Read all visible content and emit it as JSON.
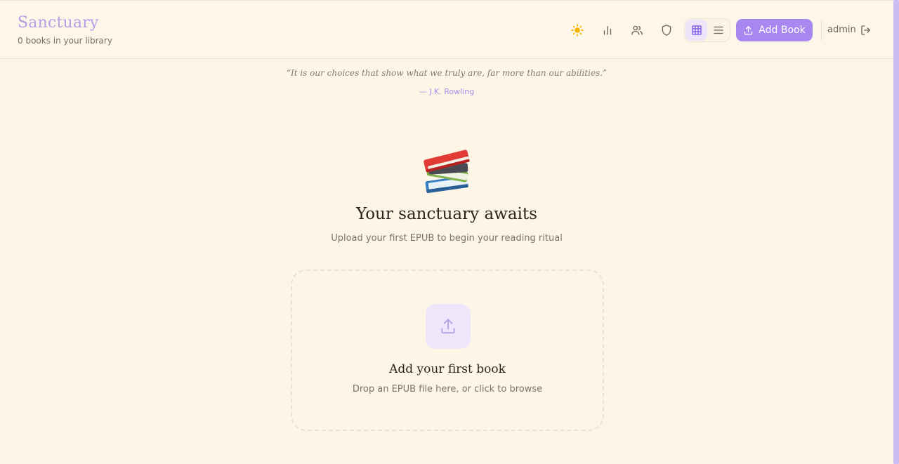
{
  "header": {
    "title": "Sanctuary",
    "subtitle": "0 books in your library",
    "icons": [
      "sun-icon",
      "stats-icon",
      "users-icon",
      "shield-icon",
      "grid-view-icon",
      "list-view-icon"
    ],
    "add_book_label": "Add Book",
    "username": "admin"
  },
  "quote": {
    "text": "“It is our choices that show what we truly are, far more than our abilities.”",
    "author": "— J.K. Rowling"
  },
  "empty_state": {
    "emoji_icon": "books-icon",
    "title": "Your sanctuary awaits",
    "subtitle": "Upload your first EPUB to begin your reading ritual"
  },
  "dropzone": {
    "title": "Add your first book",
    "subtitle": "Drop an EPUB file here, or click to browse"
  },
  "colors": {
    "background": "#fdf6e6",
    "accent": "#a987f0",
    "brand": "#b99be6",
    "sun": "#f5b400"
  }
}
